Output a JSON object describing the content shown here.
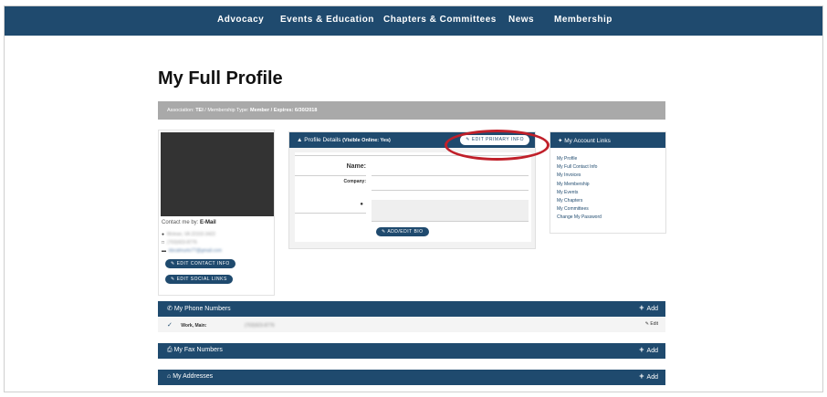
{
  "nav": {
    "items": [
      "Advocacy",
      "Events & Education",
      "Chapters & Committees",
      "News",
      "Membership"
    ]
  },
  "page": {
    "title": "My Full Profile"
  },
  "assoc_bar": {
    "assoc_label": "Association:",
    "assoc_value": "TEI",
    "type_label": "/ Membership Type:",
    "type_value": "Member",
    "expires": "/ Expires: 6/30/2018"
  },
  "left": {
    "contact_by_label": "Contact me by:",
    "contact_by_value": "E-Mail",
    "address": "Mclean, VA 22102-3422",
    "phone": "(703)923-8776",
    "email": "kbcalmurto77@gmail.com",
    "edit_contact_label": "EDIT CONTACT INFO",
    "edit_social_label": "EDIT SOCIAL LINKS"
  },
  "profile": {
    "header_title": "Profile Details",
    "header_visible": "(Visible Online: Yes)",
    "edit_primary_label": "EDIT PRIMARY INFO",
    "name_label": "Name:",
    "company_label": "Company:",
    "add_bio_label": "ADD/EDIT BIO"
  },
  "account": {
    "title": "My Account Links",
    "links": [
      "My Profile",
      "My Full Contact Info",
      "My Invoices",
      "My Membership",
      "My Events",
      "My Chapters",
      "My Committees",
      "Change My Password"
    ]
  },
  "sections": {
    "phone_title": "My Phone Numbers",
    "fax_title": "My Fax Numbers",
    "address_title": "My Addresses",
    "add_label": "Add"
  },
  "phone_row": {
    "type": "Work, Main:",
    "number": "(703)923-8776",
    "edit_label": "Edit"
  },
  "colors": {
    "brand": "#1f4a6e",
    "annotation": "#c0202a",
    "gray_bar": "#a9a9a9"
  }
}
